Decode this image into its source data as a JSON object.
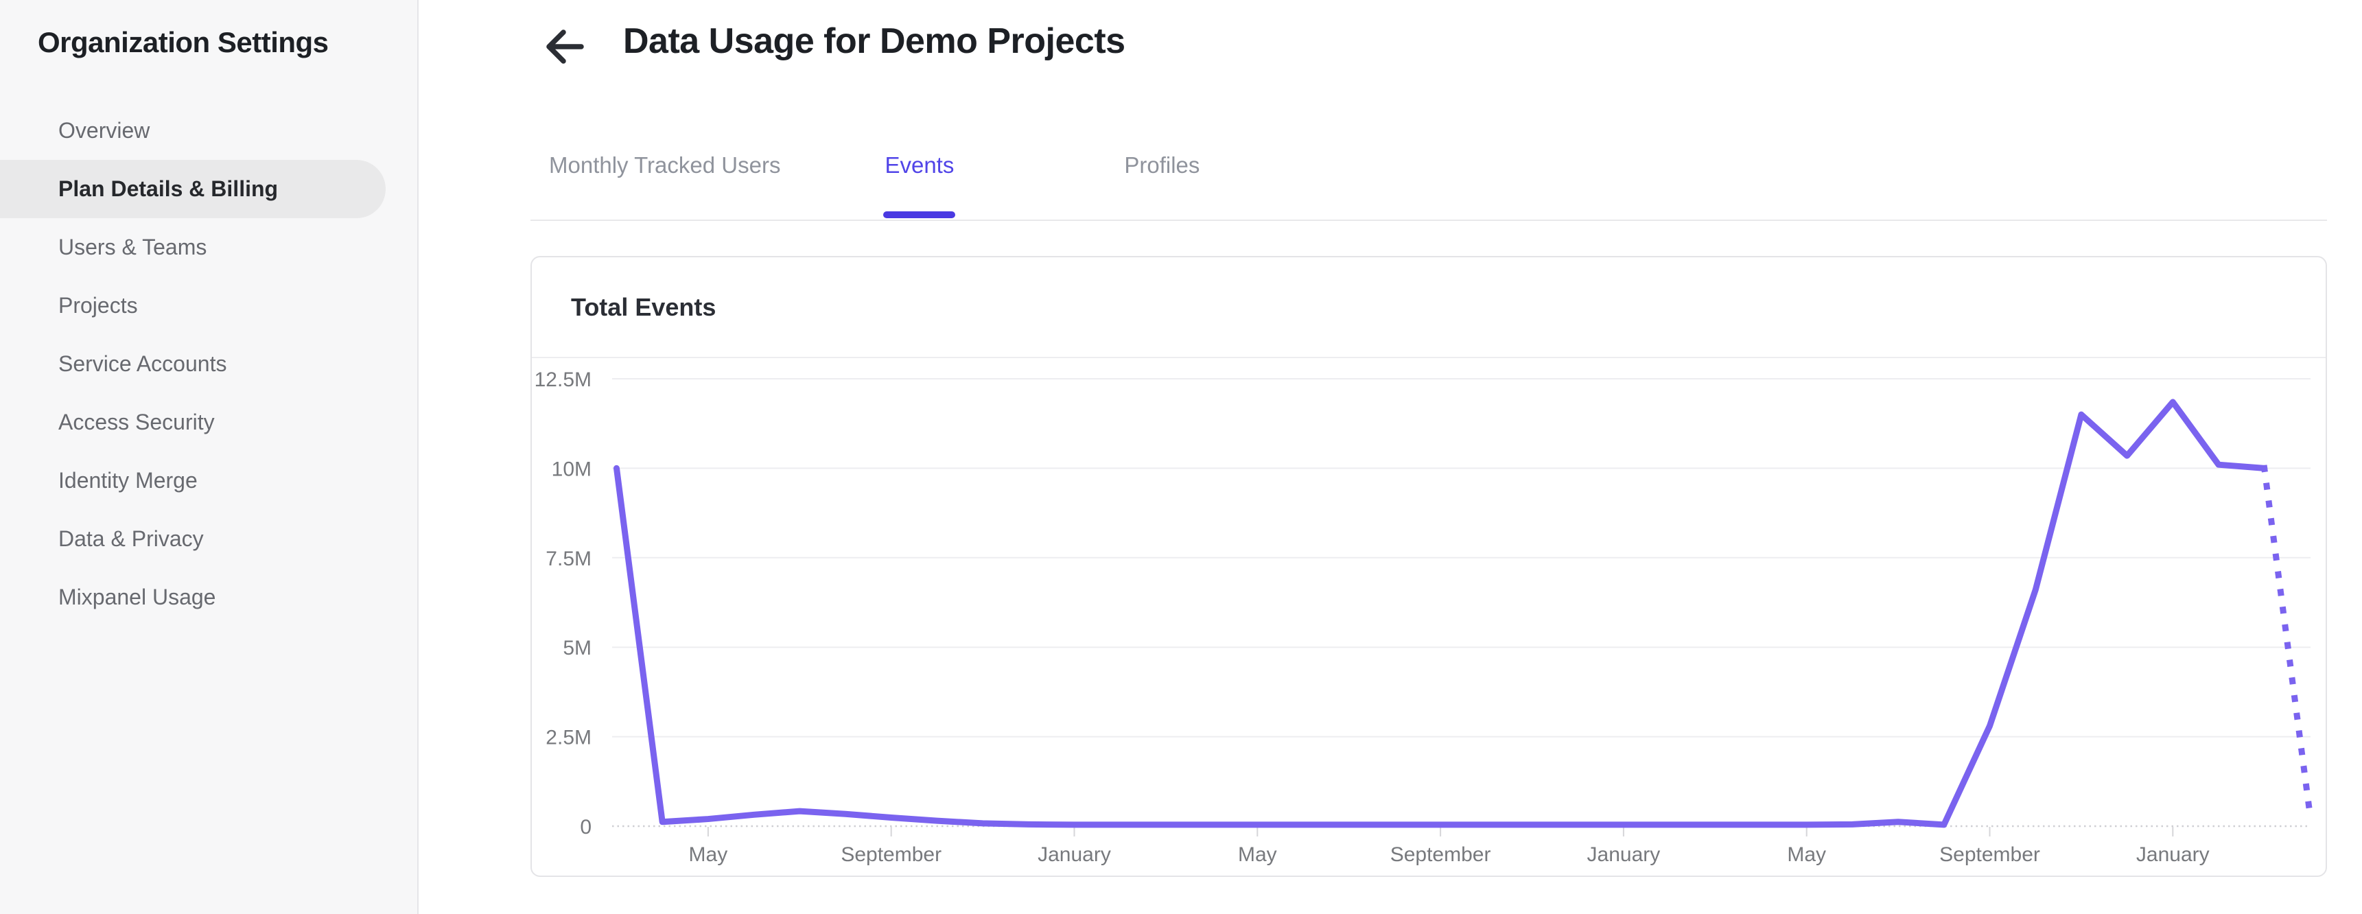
{
  "sidebar": {
    "title": "Organization Settings",
    "items": [
      {
        "label": "Overview",
        "selected": false
      },
      {
        "label": "Plan Details & Billing",
        "selected": true
      },
      {
        "label": "Users & Teams",
        "selected": false
      },
      {
        "label": "Projects",
        "selected": false
      },
      {
        "label": "Service Accounts",
        "selected": false
      },
      {
        "label": "Access Security",
        "selected": false
      },
      {
        "label": "Identity Merge",
        "selected": false
      },
      {
        "label": "Data & Privacy",
        "selected": false
      },
      {
        "label": "Mixpanel Usage",
        "selected": false
      }
    ]
  },
  "header": {
    "title": "Data Usage for Demo Projects",
    "back_icon": "arrow-left-icon"
  },
  "tabs": [
    {
      "label": "Monthly Tracked Users",
      "active": false
    },
    {
      "label": "Events",
      "active": true
    },
    {
      "label": "Profiles",
      "active": false
    }
  ],
  "card": {
    "title": "Total Events"
  },
  "colors": {
    "active_tab": "#5044e8",
    "tab_underline": "#4a3ae2",
    "line": "#7a63ef",
    "grid": "#ededf0",
    "axis_line": "#cfcfd3",
    "tick": "#d6d6d9",
    "axis_label": "#77797d",
    "selected_item_bg": "#e9e9ea",
    "sidebar_bg": "#f7f7f8",
    "title_text": "#1d2025"
  },
  "chart_data": {
    "type": "line",
    "title": "Total Events",
    "xlabel": "",
    "ylabel": "",
    "units": "events (millions)",
    "ylim": [
      0,
      12.5
    ],
    "grid": "horizontal",
    "legend": "none",
    "y_ticks": [
      {
        "value": 0,
        "label": "0"
      },
      {
        "value": 2.5,
        "label": "2.5M"
      },
      {
        "value": 5,
        "label": "5M"
      },
      {
        "value": 7.5,
        "label": "7.5M"
      },
      {
        "value": 10,
        "label": "10M"
      },
      {
        "value": 12.5,
        "label": "12.5M"
      }
    ],
    "x_ticks": [
      {
        "index": 2,
        "label": "May"
      },
      {
        "index": 6,
        "label": "September"
      },
      {
        "index": 10,
        "label": "January"
      },
      {
        "index": 14,
        "label": "May"
      },
      {
        "index": 18,
        "label": "September"
      },
      {
        "index": 22,
        "label": "January"
      },
      {
        "index": 26,
        "label": "May"
      },
      {
        "index": 30,
        "label": "September"
      },
      {
        "index": 34,
        "label": "January"
      }
    ],
    "series": [
      {
        "name": "Total Events",
        "values_millions": [
          10,
          0.12,
          0.2,
          0.32,
          0.42,
          0.34,
          0.24,
          0.15,
          0.08,
          0.05,
          0.04,
          0.04,
          0.04,
          0.04,
          0.04,
          0.04,
          0.04,
          0.04,
          0.04,
          0.04,
          0.04,
          0.04,
          0.04,
          0.04,
          0.04,
          0.04,
          0.04,
          0.05,
          0.12,
          0.04,
          2.8,
          6.6,
          11.5,
          10.35,
          11.85,
          10.1,
          10.0,
          0.3
        ]
      }
    ],
    "dotted_tail_start_index": 36
  }
}
